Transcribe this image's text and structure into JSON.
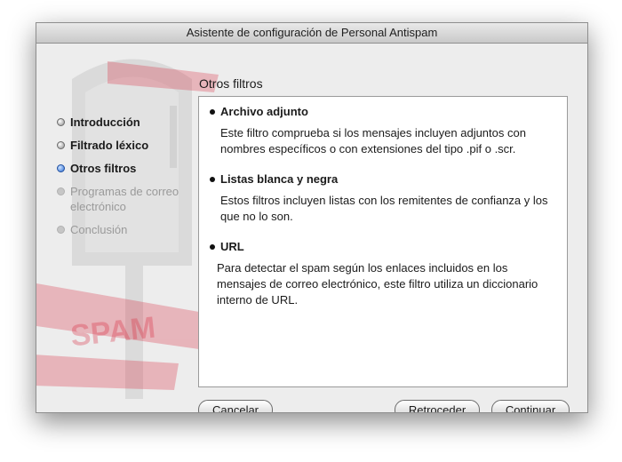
{
  "window": {
    "title": "Asistente de configuración de Personal Antispam"
  },
  "background_art": {
    "stamp_text": "SPAM"
  },
  "steps": [
    {
      "label": "Introducción",
      "state": "done"
    },
    {
      "label": "Filtrado léxico",
      "state": "done"
    },
    {
      "label": "Otros filtros",
      "state": "current"
    },
    {
      "label": "Programas de correo electrónico",
      "state": "todo"
    },
    {
      "label": "Conclusión",
      "state": "todo"
    }
  ],
  "panel": {
    "title": "Otros filtros",
    "filters": [
      {
        "name": "Archivo adjunto",
        "description": "Este filtro comprueba si los mensajes incluyen adjuntos con nombres específicos o con extensiones del tipo .pif o .scr."
      },
      {
        "name": "Listas blanca y negra",
        "description": "Estos filtros incluyen listas con los remitentes de confianza y los que no lo son."
      },
      {
        "name": "URL",
        "description": "Para detectar el spam según los enlaces incluidos en los mensajes de correo electrónico, este filtro utiliza un diccionario interno de URL."
      }
    ]
  },
  "buttons": {
    "cancel": "Cancelar",
    "back": "Retroceder",
    "continue": "Continuar"
  },
  "colors": {
    "current_step": "#2d6fd6",
    "stamp_red": "#d9243a"
  }
}
